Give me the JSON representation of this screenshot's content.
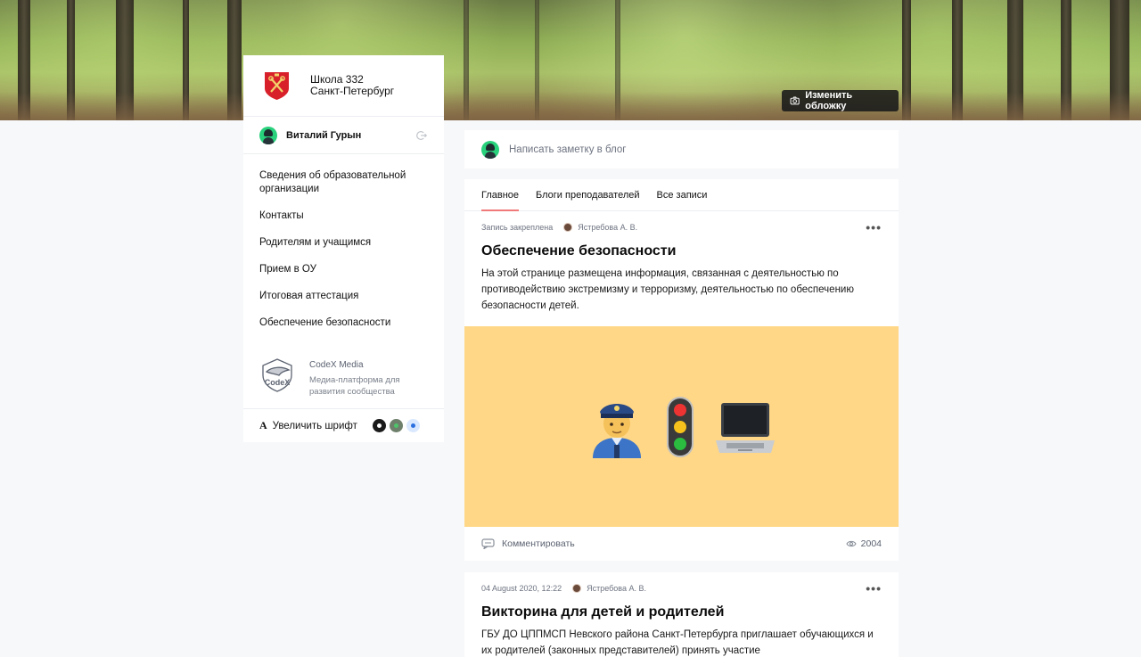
{
  "cover": {
    "change_cover_label": "Изменить обложку"
  },
  "sidebar": {
    "school_name_line1": "Школа 332",
    "school_name_line2": "Санкт-Петербург",
    "user_name": "Виталий Гурын",
    "menu": [
      "Сведения об образовательной организации",
      "Контакты",
      "Родителям и учащимся",
      "Прием в ОУ",
      "Итоговая аттестация",
      "Обеспечение безопасности"
    ],
    "codex": {
      "title": "CodeX Media",
      "description": "Медиа-платформа для развития сообщества"
    },
    "font_label": "Увеличить шрифт",
    "font_icon": "A",
    "theme_colors": [
      "#1a1a1a",
      "#6e7f6b",
      "#d9e8ff"
    ]
  },
  "compose": {
    "placeholder": "Написать заметку в блог"
  },
  "tabs": [
    {
      "label": "Главное",
      "active": true
    },
    {
      "label": "Блоги преподавателей",
      "active": false
    },
    {
      "label": "Все записи",
      "active": false
    }
  ],
  "posts": [
    {
      "meta": "Запись закреплена",
      "author": "Ястребова А. В.",
      "title": "Обеспечение безопасности",
      "body": "На этой странице размещена информация, связанная с деятельностью по противодействию экстремизму и терроризму, деятельностью по обеспечению безопасности детей.",
      "cover_color": "#ffd787",
      "cover_icons": [
        "police-officer-icon",
        "traffic-light-icon",
        "laptop-icon"
      ],
      "comment_label": "Комментировать",
      "views": "2004"
    },
    {
      "meta": "04 August 2020, 12:22",
      "author": "Ястребова А. В.",
      "title": "Викторина для детей и родителей",
      "body": "ГБУ ДО ЦППМСП Невского района Санкт-Петербурга приглашает обучающихся и их родителей (законных представителей) принять участие"
    }
  ]
}
